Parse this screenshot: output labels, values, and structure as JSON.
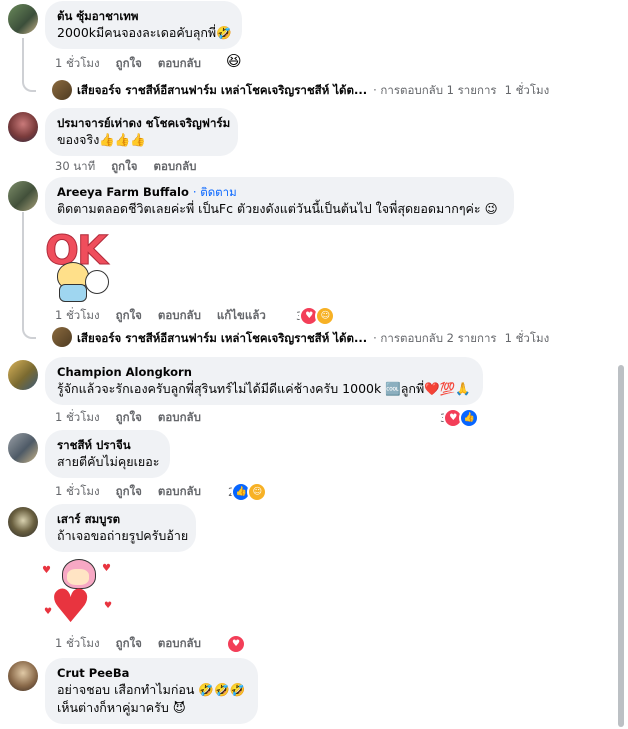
{
  "comments": [
    {
      "name": "ต้น ซุ้มอาชาเทพ",
      "lines": [
        "2000kมีคนจองละเดอคับลุกพี่🤣"
      ],
      "time": "1 ชั่วโมง",
      "like": "ถูกใจ",
      "reply": "ตอบกลับ",
      "reaction_emoji": "😆",
      "replies_row": {
        "names": "เสียจอร์จ ราชสีห์อีสานฟาร์ม เหล่าโชคเจริญราชสีห์ ได้ต...",
        "text": "· การตอบกลับ 1 รายการ",
        "time": "1 ชั่วโมง"
      }
    },
    {
      "name": "ปรมาจารย์เห่าดง ชโชคเจริญฟาร์ม",
      "lines": [
        "ของจริง👍👍👍"
      ],
      "time": "30 นาที",
      "like": "ถูกใจ",
      "reply": "ตอบกลับ"
    },
    {
      "name": "Areeya Farm Buffalo",
      "follow": "· ติดตาม",
      "lines": [
        "ติดตามตลอดชีวิตเลยค่ะพี่ เป็นFc ตัวยงดังแต่วันนี้เป็นต้นไป ใจพี่สุดยอดมากๆค่ะ 😉"
      ],
      "sticker_text": "OK",
      "time": "1 ชั่วโมง",
      "like": "ถูกใจ",
      "reply": "ตอบกลับ",
      "edited": "แก้ไขแล้ว",
      "reaction_count": "3",
      "replies_row": {
        "names": "เสียจอร์จ ราชสีห์อีสานฟาร์ม เหล่าโชคเจริญราชสีห์ ได้ต...",
        "text": "· การตอบกลับ 2 รายการ",
        "time": "1 ชั่วโมง"
      }
    },
    {
      "name": "Champion Alongkorn",
      "lines": [
        "รู้จักแล้วจะรักเองครับลูกพี่สุรินทร์ไม่ได้มีดีแค่ช้างครับ 1000k 🆒ลูกพี่❤️💯🙏"
      ],
      "time": "1 ชั่วโมง",
      "like": "ถูกใจ",
      "reply": "ตอบกลับ",
      "reaction_count": "3"
    },
    {
      "name": "ราชสีห์ ปราจีน",
      "lines": [
        "สายตีคับไม่คุยเยอะ"
      ],
      "time": "1 ชั่วโมง",
      "like": "ถูกใจ",
      "reply": "ตอบกลับ",
      "reaction_count": "2"
    },
    {
      "name": "เสาร์ สมบูรต",
      "lines": [
        "ถ้าเจอขอถ่ายรูปครับอ้าย"
      ],
      "time": "1 ชั่วโมง",
      "like": "ถูกใจ",
      "reply": "ตอบกลับ"
    },
    {
      "name": "Crut PeeBa",
      "lines": [
        "อย่าจชอบ เสือกทำไมก่อน 🤣🤣🤣",
        "เห็นต่างก็หาคู่มาครับ 😈"
      ]
    }
  ],
  "colors": {
    "bubble": "#f0f2f5",
    "link": "#0866ff",
    "meta": "#65676b",
    "love": "#f33e58",
    "like": "#0866ff"
  },
  "icons": [
    "love-icon",
    "like-icon",
    "haha-icon"
  ]
}
